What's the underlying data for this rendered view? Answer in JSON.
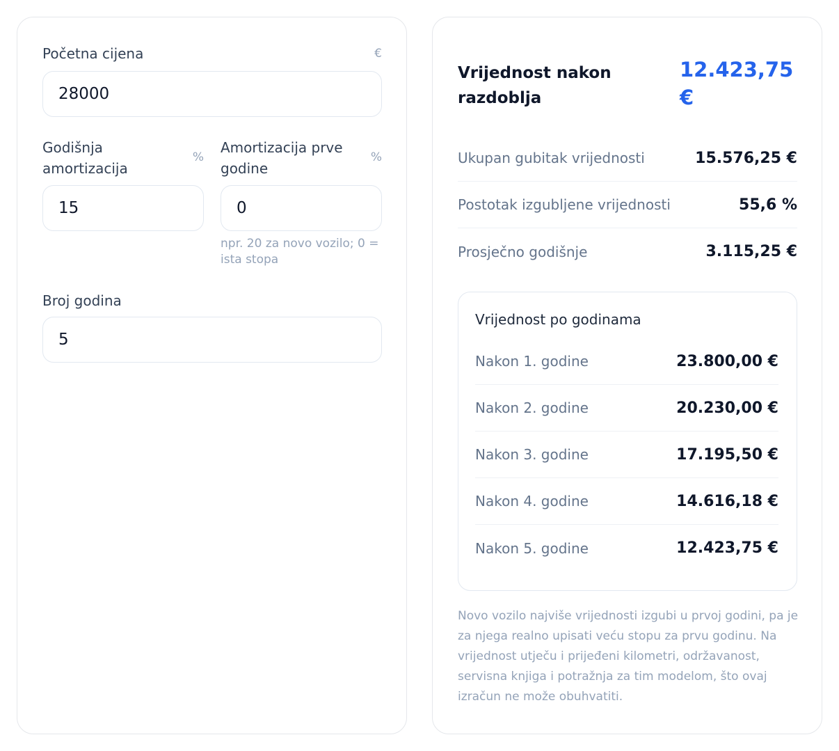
{
  "inputs": {
    "start_price": {
      "label": "Početna cijena",
      "unit": "€",
      "value": "28000"
    },
    "annual_rate": {
      "label": "Godišnja amortizacija",
      "unit": "%",
      "value": "15"
    },
    "first_year_rate": {
      "label": "Amortizacija prve godine",
      "unit": "%",
      "value": "0",
      "hint": "npr. 20 za novo vozilo; 0 = ista stopa"
    },
    "years": {
      "label": "Broj godina",
      "value": "5"
    }
  },
  "result": {
    "hero_label": "Vrijednost nakon razdoblja",
    "hero_value": "12.423,75 €",
    "stats": [
      {
        "label": "Ukupan gubitak vrijednosti",
        "value": "15.576,25 €"
      },
      {
        "label": "Postotak izgubljene vrijednosti",
        "value": "55,6 %"
      },
      {
        "label": "Prosječno godišnje",
        "value": "3.115,25 €"
      }
    ],
    "by_year": {
      "title": "Vrijednost po godinama",
      "rows": [
        {
          "label": "Nakon 1. godine",
          "value": "23.800,00 €"
        },
        {
          "label": "Nakon 2. godine",
          "value": "20.230,00 €"
        },
        {
          "label": "Nakon 3. godine",
          "value": "17.195,50 €"
        },
        {
          "label": "Nakon 4. godine",
          "value": "14.616,18 €"
        },
        {
          "label": "Nakon 5. godine",
          "value": "12.423,75 €"
        }
      ]
    },
    "note": "Novo vozilo najviše vrijednosti izgubi u prvoj godini, pa je za njega realno upisati veću stopu za prvu godinu. Na vrijednost utječu i prijeđeni kilometri, održavanost, servisna knjiga i potražnja za tim modelom, što ovaj izračun ne može obuhvatiti."
  },
  "colors": {
    "accent": "#2563eb",
    "border": "#e5e7eb",
    "muted": "#64748b"
  }
}
